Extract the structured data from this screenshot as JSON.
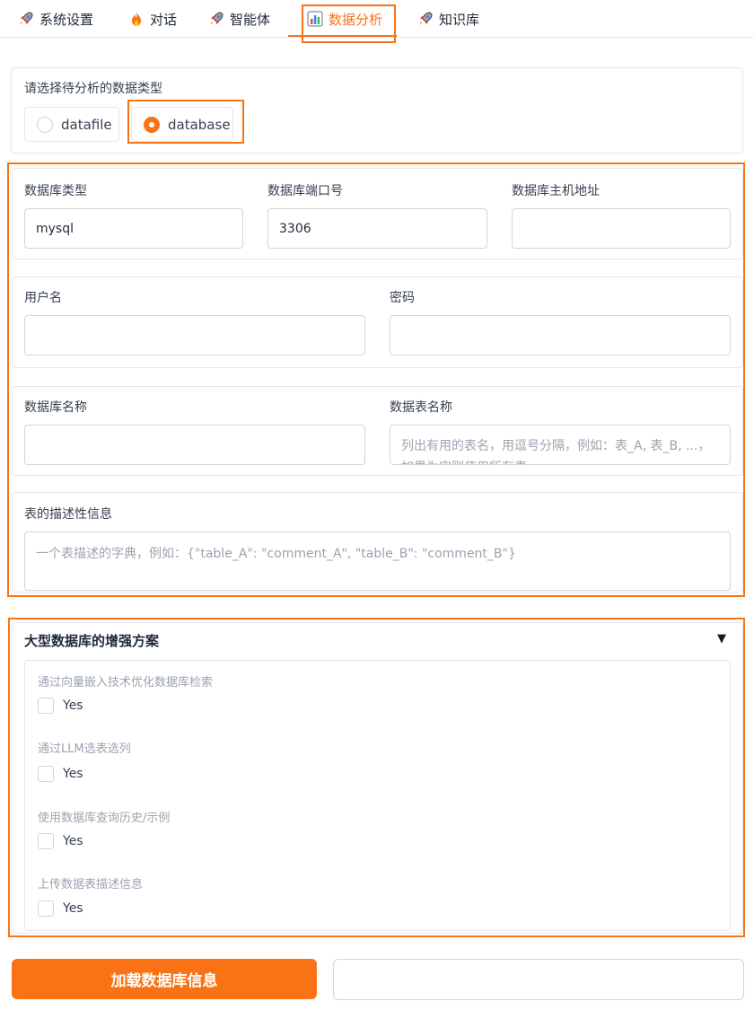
{
  "tabs": [
    {
      "label": "系统设置",
      "icon": "rocket-icon"
    },
    {
      "label": "对话",
      "icon": "fire-icon"
    },
    {
      "label": "智能体",
      "icon": "rocket-icon"
    },
    {
      "label": "数据分析",
      "icon": "bar-chart-icon",
      "active": true
    },
    {
      "label": "知识库",
      "icon": "rocket-icon"
    }
  ],
  "data_type": {
    "label": "请选择待分析的数据类型",
    "options": [
      "datafile",
      "database"
    ],
    "selected": "database"
  },
  "db_conn": {
    "type_label": "数据库类型",
    "type_value": "mysql",
    "port_label": "数据库端口号",
    "port_value": "3306",
    "host_label": "数据库主机地址",
    "host_value": ""
  },
  "credentials": {
    "user_label": "用户名",
    "user_value": "",
    "password_label": "密码",
    "password_value": ""
  },
  "db_names": {
    "db_name_label": "数据库名称",
    "db_name_value": "",
    "table_name_label": "数据表名称",
    "table_name_placeholder": "列出有用的表名，用逗号分隔，例如：表_A, 表_B, ...，如果为空则使用所有表。"
  },
  "table_desc": {
    "label": "表的描述性信息",
    "placeholder": "一个表描述的字典，例如：{\"table_A\": \"comment_A\", \"table_B\": \"comment_B\"}"
  },
  "enhance": {
    "title": "大型数据库的增强方案",
    "arrow": "▼",
    "options": [
      {
        "label": "通过向量嵌入技术优化数据库检索",
        "check_label": "Yes",
        "checked": false
      },
      {
        "label": "通过LLM选表选列",
        "check_label": "Yes",
        "checked": false
      },
      {
        "label": "使用数据库查询历史/示例",
        "check_label": "Yes",
        "checked": false
      },
      {
        "label": "上传数据表描述信息",
        "check_label": "Yes",
        "checked": false
      }
    ]
  },
  "load_button": "加载数据库信息",
  "colors": {
    "accent": "#f97316",
    "border": "#e5e7eb",
    "text": "#1f2937",
    "muted": "#9ca3af"
  }
}
